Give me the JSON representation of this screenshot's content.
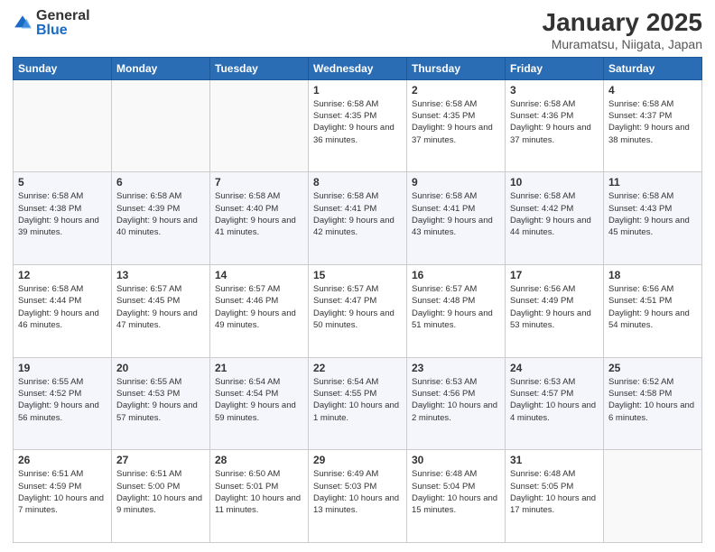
{
  "header": {
    "logo_general": "General",
    "logo_blue": "Blue",
    "title": "January 2025",
    "subtitle": "Muramatsu, Niigata, Japan"
  },
  "days_of_week": [
    "Sunday",
    "Monday",
    "Tuesday",
    "Wednesday",
    "Thursday",
    "Friday",
    "Saturday"
  ],
  "weeks": [
    [
      {
        "day": "",
        "sunrise": "",
        "sunset": "",
        "daylight": ""
      },
      {
        "day": "",
        "sunrise": "",
        "sunset": "",
        "daylight": ""
      },
      {
        "day": "",
        "sunrise": "",
        "sunset": "",
        "daylight": ""
      },
      {
        "day": "1",
        "sunrise": "Sunrise: 6:58 AM",
        "sunset": "Sunset: 4:35 PM",
        "daylight": "Daylight: 9 hours and 36 minutes."
      },
      {
        "day": "2",
        "sunrise": "Sunrise: 6:58 AM",
        "sunset": "Sunset: 4:35 PM",
        "daylight": "Daylight: 9 hours and 37 minutes."
      },
      {
        "day": "3",
        "sunrise": "Sunrise: 6:58 AM",
        "sunset": "Sunset: 4:36 PM",
        "daylight": "Daylight: 9 hours and 37 minutes."
      },
      {
        "day": "4",
        "sunrise": "Sunrise: 6:58 AM",
        "sunset": "Sunset: 4:37 PM",
        "daylight": "Daylight: 9 hours and 38 minutes."
      }
    ],
    [
      {
        "day": "5",
        "sunrise": "Sunrise: 6:58 AM",
        "sunset": "Sunset: 4:38 PM",
        "daylight": "Daylight: 9 hours and 39 minutes."
      },
      {
        "day": "6",
        "sunrise": "Sunrise: 6:58 AM",
        "sunset": "Sunset: 4:39 PM",
        "daylight": "Daylight: 9 hours and 40 minutes."
      },
      {
        "day": "7",
        "sunrise": "Sunrise: 6:58 AM",
        "sunset": "Sunset: 4:40 PM",
        "daylight": "Daylight: 9 hours and 41 minutes."
      },
      {
        "day": "8",
        "sunrise": "Sunrise: 6:58 AM",
        "sunset": "Sunset: 4:41 PM",
        "daylight": "Daylight: 9 hours and 42 minutes."
      },
      {
        "day": "9",
        "sunrise": "Sunrise: 6:58 AM",
        "sunset": "Sunset: 4:41 PM",
        "daylight": "Daylight: 9 hours and 43 minutes."
      },
      {
        "day": "10",
        "sunrise": "Sunrise: 6:58 AM",
        "sunset": "Sunset: 4:42 PM",
        "daylight": "Daylight: 9 hours and 44 minutes."
      },
      {
        "day": "11",
        "sunrise": "Sunrise: 6:58 AM",
        "sunset": "Sunset: 4:43 PM",
        "daylight": "Daylight: 9 hours and 45 minutes."
      }
    ],
    [
      {
        "day": "12",
        "sunrise": "Sunrise: 6:58 AM",
        "sunset": "Sunset: 4:44 PM",
        "daylight": "Daylight: 9 hours and 46 minutes."
      },
      {
        "day": "13",
        "sunrise": "Sunrise: 6:57 AM",
        "sunset": "Sunset: 4:45 PM",
        "daylight": "Daylight: 9 hours and 47 minutes."
      },
      {
        "day": "14",
        "sunrise": "Sunrise: 6:57 AM",
        "sunset": "Sunset: 4:46 PM",
        "daylight": "Daylight: 9 hours and 49 minutes."
      },
      {
        "day": "15",
        "sunrise": "Sunrise: 6:57 AM",
        "sunset": "Sunset: 4:47 PM",
        "daylight": "Daylight: 9 hours and 50 minutes."
      },
      {
        "day": "16",
        "sunrise": "Sunrise: 6:57 AM",
        "sunset": "Sunset: 4:48 PM",
        "daylight": "Daylight: 9 hours and 51 minutes."
      },
      {
        "day": "17",
        "sunrise": "Sunrise: 6:56 AM",
        "sunset": "Sunset: 4:49 PM",
        "daylight": "Daylight: 9 hours and 53 minutes."
      },
      {
        "day": "18",
        "sunrise": "Sunrise: 6:56 AM",
        "sunset": "Sunset: 4:51 PM",
        "daylight": "Daylight: 9 hours and 54 minutes."
      }
    ],
    [
      {
        "day": "19",
        "sunrise": "Sunrise: 6:55 AM",
        "sunset": "Sunset: 4:52 PM",
        "daylight": "Daylight: 9 hours and 56 minutes."
      },
      {
        "day": "20",
        "sunrise": "Sunrise: 6:55 AM",
        "sunset": "Sunset: 4:53 PM",
        "daylight": "Daylight: 9 hours and 57 minutes."
      },
      {
        "day": "21",
        "sunrise": "Sunrise: 6:54 AM",
        "sunset": "Sunset: 4:54 PM",
        "daylight": "Daylight: 9 hours and 59 minutes."
      },
      {
        "day": "22",
        "sunrise": "Sunrise: 6:54 AM",
        "sunset": "Sunset: 4:55 PM",
        "daylight": "Daylight: 10 hours and 1 minute."
      },
      {
        "day": "23",
        "sunrise": "Sunrise: 6:53 AM",
        "sunset": "Sunset: 4:56 PM",
        "daylight": "Daylight: 10 hours and 2 minutes."
      },
      {
        "day": "24",
        "sunrise": "Sunrise: 6:53 AM",
        "sunset": "Sunset: 4:57 PM",
        "daylight": "Daylight: 10 hours and 4 minutes."
      },
      {
        "day": "25",
        "sunrise": "Sunrise: 6:52 AM",
        "sunset": "Sunset: 4:58 PM",
        "daylight": "Daylight: 10 hours and 6 minutes."
      }
    ],
    [
      {
        "day": "26",
        "sunrise": "Sunrise: 6:51 AM",
        "sunset": "Sunset: 4:59 PM",
        "daylight": "Daylight: 10 hours and 7 minutes."
      },
      {
        "day": "27",
        "sunrise": "Sunrise: 6:51 AM",
        "sunset": "Sunset: 5:00 PM",
        "daylight": "Daylight: 10 hours and 9 minutes."
      },
      {
        "day": "28",
        "sunrise": "Sunrise: 6:50 AM",
        "sunset": "Sunset: 5:01 PM",
        "daylight": "Daylight: 10 hours and 11 minutes."
      },
      {
        "day": "29",
        "sunrise": "Sunrise: 6:49 AM",
        "sunset": "Sunset: 5:03 PM",
        "daylight": "Daylight: 10 hours and 13 minutes."
      },
      {
        "day": "30",
        "sunrise": "Sunrise: 6:48 AM",
        "sunset": "Sunset: 5:04 PM",
        "daylight": "Daylight: 10 hours and 15 minutes."
      },
      {
        "day": "31",
        "sunrise": "Sunrise: 6:48 AM",
        "sunset": "Sunset: 5:05 PM",
        "daylight": "Daylight: 10 hours and 17 minutes."
      },
      {
        "day": "",
        "sunrise": "",
        "sunset": "",
        "daylight": ""
      }
    ]
  ]
}
